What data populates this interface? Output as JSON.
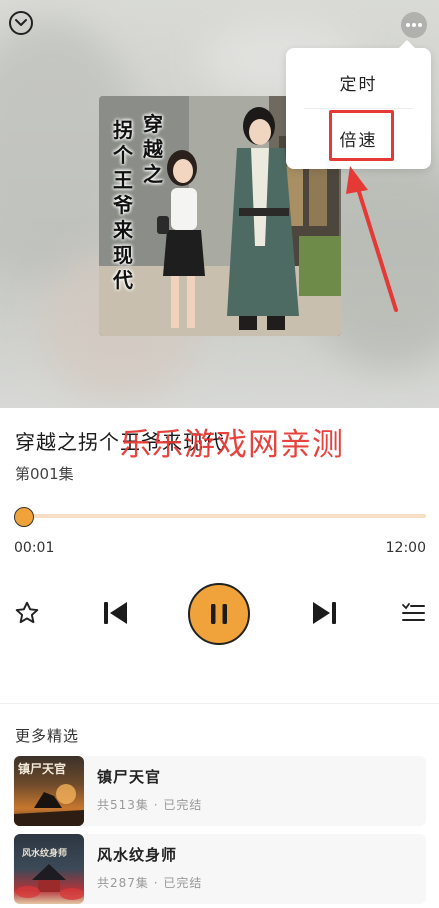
{
  "header": {
    "collapse_icon": "chevron-down-circle-icon",
    "more_icon": "more-dots-icon"
  },
  "cover": {
    "title_col1": "穿越之",
    "title_col2": "拐个王爷来现代"
  },
  "menu": {
    "timer_label": "定时",
    "speed_label": "倍速",
    "highlight_color": "#e53935"
  },
  "player": {
    "title": "穿越之拐个王爷来现代",
    "watermark": "乐乐游戏网亲测",
    "episode": "第001集",
    "current_time": "00:01",
    "total_time": "12:00",
    "progress": 0.0,
    "accent_color": "#f0a33a",
    "state": "playing"
  },
  "controls": {
    "favorite_icon": "star-icon",
    "prev_icon": "skip-previous-icon",
    "play_icon": "pause-icon",
    "next_icon": "skip-next-icon",
    "playlist_icon": "playlist-icon"
  },
  "more": {
    "heading": "更多精选",
    "items": [
      {
        "name": "镇尸天官",
        "meta": "共513集 · 已完结",
        "thumb_text": "镇尸天官"
      },
      {
        "name": "风水纹身师",
        "meta": "共287集 · 已完结",
        "thumb_text": "风水纹身师"
      }
    ]
  }
}
